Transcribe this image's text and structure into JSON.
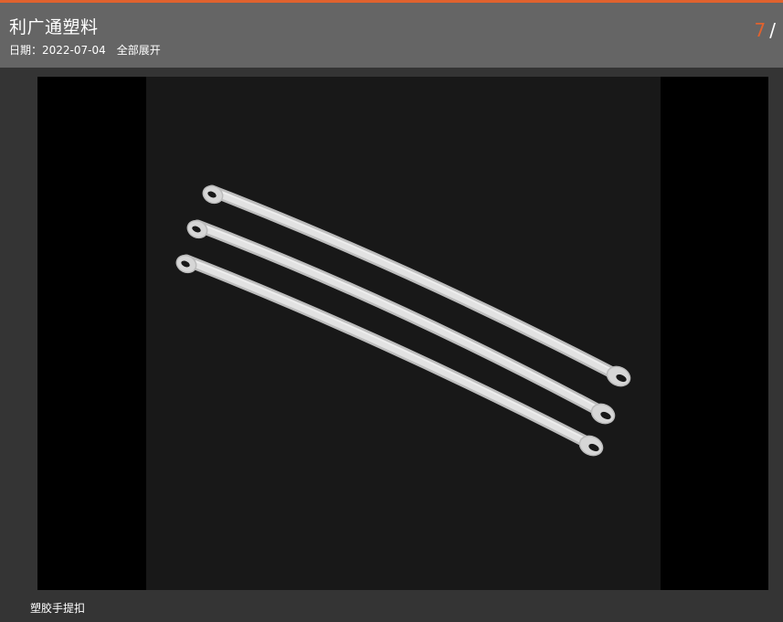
{
  "header": {
    "title": "利广通塑料",
    "date_label": "日期：",
    "date_value": "2022-07-04",
    "expand_label": "全部展开"
  },
  "counter": {
    "current": "7",
    "separator": "/"
  },
  "gallery": {
    "caption": "塑胶手提扣"
  },
  "colors": {
    "accent": "#e0622e",
    "header_bg": "#656565",
    "page_bg": "#343434",
    "photo_bg": "#181818",
    "strap": "#d8d8d8"
  }
}
